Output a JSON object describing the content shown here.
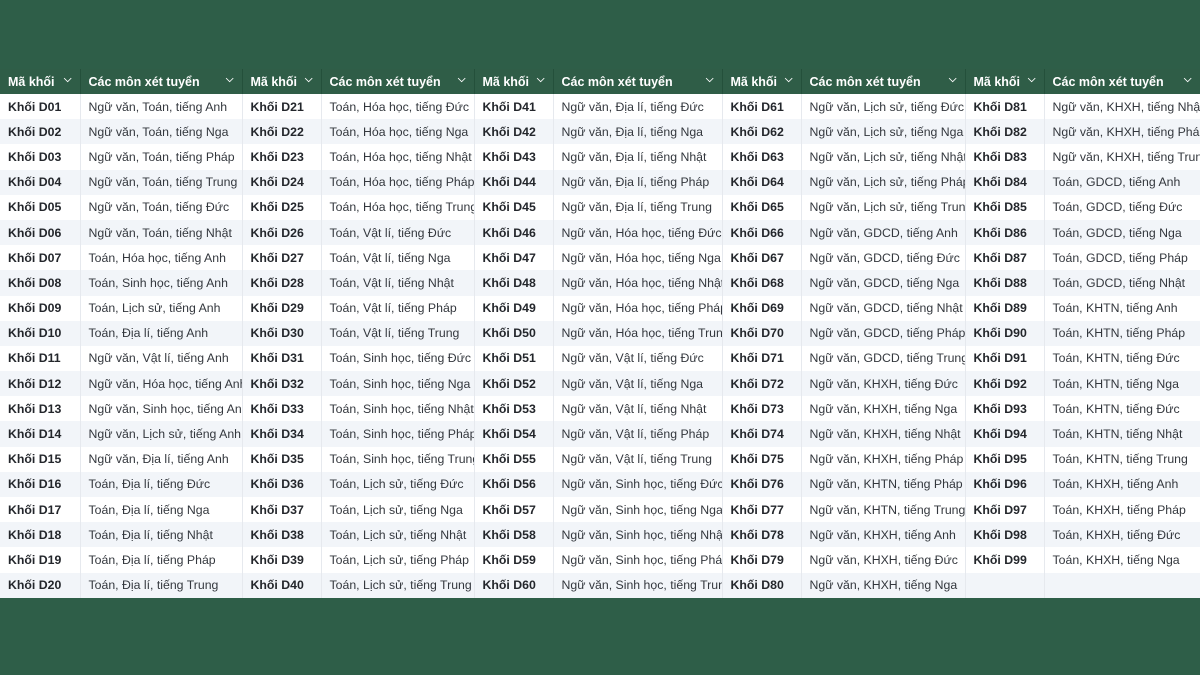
{
  "header": {
    "code_label": "Mã khối",
    "subjects_label": "Các môn xét tuyển",
    "chevron_icon": "chevron-down-icon"
  },
  "columns": [
    {
      "rows": [
        [
          "Khối D01",
          "Ngữ văn, Toán, tiếng Anh"
        ],
        [
          "Khối D02",
          "Ngữ văn, Toán, tiếng Nga"
        ],
        [
          "Khối D03",
          "Ngữ văn, Toán, tiếng Pháp"
        ],
        [
          "Khối D04",
          "Ngữ văn, Toán, tiếng Trung"
        ],
        [
          "Khối D05",
          "Ngữ văn, Toán, tiếng Đức"
        ],
        [
          "Khối D06",
          "Ngữ văn, Toán, tiếng Nhật"
        ],
        [
          "Khối D07",
          "Toán, Hóa học, tiếng Anh"
        ],
        [
          "Khối D08",
          "Toán, Sinh học, tiếng Anh"
        ],
        [
          "Khối D09",
          "Toán, Lịch sử, tiếng Anh"
        ],
        [
          "Khối D10",
          "Toán, Địa lí, tiếng Anh"
        ],
        [
          "Khối D11",
          "Ngữ văn, Vật lí, tiếng Anh"
        ],
        [
          "Khối D12",
          "Ngữ văn, Hóa học, tiếng Anh"
        ],
        [
          "Khối D13",
          "Ngữ văn, Sinh học, tiếng Anh"
        ],
        [
          "Khối D14",
          "Ngữ văn, Lịch sử, tiếng Anh"
        ],
        [
          "Khối D15",
          "Ngữ văn, Địa lí, tiếng Anh"
        ],
        [
          "Khối D16",
          "Toán, Địa lí, tiếng Đức"
        ],
        [
          "Khối D17",
          "Toán, Địa lí, tiếng Nga"
        ],
        [
          "Khối D18",
          "Toán, Địa lí, tiếng Nhật"
        ],
        [
          "Khối D19",
          "Toán, Địa lí, tiếng Pháp"
        ],
        [
          "Khối D20",
          "Toán, Địa lí, tiếng Trung"
        ]
      ]
    },
    {
      "rows": [
        [
          "Khối D21",
          "Toán, Hóa học, tiếng Đức"
        ],
        [
          "Khối D22",
          "Toán, Hóa học, tiếng Nga"
        ],
        [
          "Khối D23",
          "Toán, Hóa học, tiếng Nhật"
        ],
        [
          "Khối D24",
          "Toán, Hóa học, tiếng Pháp"
        ],
        [
          "Khối D25",
          "Toán, Hóa học, tiếng Trung"
        ],
        [
          "Khối D26",
          "Toán, Vật lí, tiếng Đức"
        ],
        [
          "Khối D27",
          "Toán, Vật lí, tiếng Nga"
        ],
        [
          "Khối D28",
          "Toán, Vật lí, tiếng Nhật"
        ],
        [
          "Khối D29",
          "Toán, Vật lí, tiếng Pháp"
        ],
        [
          "Khối D30",
          "Toán, Vật lí, tiếng Trung"
        ],
        [
          "Khối D31",
          "Toán, Sinh học, tiếng Đức"
        ],
        [
          "Khối D32",
          "Toán, Sinh học, tiếng Nga"
        ],
        [
          "Khối D33",
          "Toán, Sinh học, tiếng Nhật"
        ],
        [
          "Khối D34",
          "Toán, Sinh học, tiếng Pháp"
        ],
        [
          "Khối D35",
          "Toán, Sinh học, tiếng Trung"
        ],
        [
          "Khối D36",
          "Toán, Lịch sử, tiếng Đức"
        ],
        [
          "Khối D37",
          "Toán, Lịch sử, tiếng Nga"
        ],
        [
          "Khối D38",
          "Toán, Lịch sử, tiếng Nhật"
        ],
        [
          "Khối D39",
          "Toán, Lịch sử, tiếng Pháp"
        ],
        [
          "Khối D40",
          "Toán, Lịch sử, tiếng Trung"
        ]
      ]
    },
    {
      "rows": [
        [
          "Khối D41",
          "Ngữ văn, Địa lí, tiếng Đức"
        ],
        [
          "Khối D42",
          "Ngữ văn, Địa lí, tiếng Nga"
        ],
        [
          "Khối D43",
          "Ngữ văn, Địa lí, tiếng Nhật"
        ],
        [
          "Khối D44",
          "Ngữ văn, Địa lí, tiếng Pháp"
        ],
        [
          "Khối D45",
          "Ngữ văn, Địa lí, tiếng Trung"
        ],
        [
          "Khối D46",
          "Ngữ văn, Hóa học, tiếng Đức"
        ],
        [
          "Khối D47",
          "Ngữ văn, Hóa học, tiếng Nga"
        ],
        [
          "Khối D48",
          "Ngữ văn, Hóa học, tiếng Nhật"
        ],
        [
          "Khối D49",
          "Ngữ văn, Hóa học, tiếng Pháp"
        ],
        [
          "Khối D50",
          "Ngữ văn, Hóa học, tiếng Trung"
        ],
        [
          "Khối D51",
          "Ngữ văn, Vật lí, tiếng Đức"
        ],
        [
          "Khối D52",
          "Ngữ văn, Vật lí, tiếng Nga"
        ],
        [
          "Khối D53",
          "Ngữ văn, Vật lí, tiếng Nhật"
        ],
        [
          "Khối D54",
          "Ngữ văn, Vật lí, tiếng Pháp"
        ],
        [
          "Khối D55",
          "Ngữ văn, Vật lí, tiếng Trung"
        ],
        [
          "Khối D56",
          "Ngữ văn, Sinh học, tiếng Đức"
        ],
        [
          "Khối D57",
          "Ngữ văn, Sinh học, tiếng Nga"
        ],
        [
          "Khối D58",
          "Ngữ văn, Sinh học, tiếng Nhật"
        ],
        [
          "Khối D59",
          "Ngữ văn, Sinh học, tiếng Pháp"
        ],
        [
          "Khối D60",
          "Ngữ văn, Sinh học, tiếng Trung"
        ]
      ]
    },
    {
      "rows": [
        [
          "Khối D61",
          "Ngữ văn, Lịch sử, tiếng Đức"
        ],
        [
          "Khối D62",
          "Ngữ văn, Lịch sử, tiếng Nga"
        ],
        [
          "Khối D63",
          "Ngữ văn, Lịch sử, tiếng Nhật"
        ],
        [
          "Khối D64",
          "Ngữ văn, Lịch sử, tiếng Pháp"
        ],
        [
          "Khối D65",
          "Ngữ văn, Lịch sử, tiếng Trung"
        ],
        [
          "Khối D66",
          "Ngữ văn, GDCD, tiếng Anh"
        ],
        [
          "Khối D67",
          "Ngữ văn, GDCD, tiếng Đức"
        ],
        [
          "Khối D68",
          "Ngữ văn, GDCD, tiếng Nga"
        ],
        [
          "Khối D69",
          "Ngữ văn, GDCD, tiếng Nhật"
        ],
        [
          "Khối D70",
          "Ngữ văn, GDCD, tiếng Pháp"
        ],
        [
          "Khối D71",
          "Ngữ văn, GDCD, tiếng Trung"
        ],
        [
          "Khối D72",
          "Ngữ văn, KHXH, tiếng Đức"
        ],
        [
          "Khối D73",
          "Ngữ văn, KHXH, tiếng Nga"
        ],
        [
          "Khối D74",
          "Ngữ văn, KHXH, tiếng Nhật"
        ],
        [
          "Khối D75",
          "Ngữ văn, KHXH, tiếng Pháp"
        ],
        [
          "Khối D76",
          "Ngữ văn, KHTN, tiếng Pháp"
        ],
        [
          "Khối D77",
          "Ngữ văn, KHTN, tiếng Trung"
        ],
        [
          "Khối D78",
          "Ngữ văn, KHXH, tiếng Anh"
        ],
        [
          "Khối D79",
          "Ngữ văn, KHXH, tiếng Đức"
        ],
        [
          "Khối D80",
          "Ngữ văn, KHXH, tiếng Nga"
        ]
      ]
    },
    {
      "rows": [
        [
          "Khối D81",
          "Ngữ văn, KHXH, tiếng Nhật"
        ],
        [
          "Khối D82",
          "Ngữ văn, KHXH, tiếng Pháp"
        ],
        [
          "Khối D83",
          "Ngữ văn, KHXH, tiếng Trung"
        ],
        [
          "Khối D84",
          "Toán, GDCD, tiếng Anh"
        ],
        [
          "Khối D85",
          "Toán, GDCD, tiếng Đức"
        ],
        [
          "Khối D86",
          "Toán, GDCD, tiếng Nga"
        ],
        [
          "Khối D87",
          "Toán, GDCD, tiếng Pháp"
        ],
        [
          "Khối D88",
          "Toán, GDCD, tiếng Nhật"
        ],
        [
          "Khối D89",
          "Toán, KHTN, tiếng Anh"
        ],
        [
          "Khối D90",
          "Toán, KHTN, tiếng Pháp"
        ],
        [
          "Khối D91",
          "Toán, KHTN, tiếng Đức"
        ],
        [
          "Khối D92",
          "Toán, KHTN, tiếng Nga"
        ],
        [
          "Khối D93",
          "Toán, KHTN, tiếng Đức"
        ],
        [
          "Khối D94",
          "Toán, KHTN, tiếng Nhật"
        ],
        [
          "Khối D95",
          "Toán, KHTN, tiếng Trung"
        ],
        [
          "Khối D96",
          "Toán, KHXH, tiếng Anh"
        ],
        [
          "Khối D97",
          "Toán, KHXH, tiếng Pháp"
        ],
        [
          "Khối D98",
          "Toán, KHXH, tiếng Đức"
        ],
        [
          "Khối D99",
          "Toán, KHXH, tiếng Nga"
        ],
        [
          "",
          ""
        ]
      ]
    }
  ],
  "colors": {
    "header_bg": "#2f5d47",
    "page_bg": "#2e5e48",
    "row_alt": "#f2f5f9"
  }
}
